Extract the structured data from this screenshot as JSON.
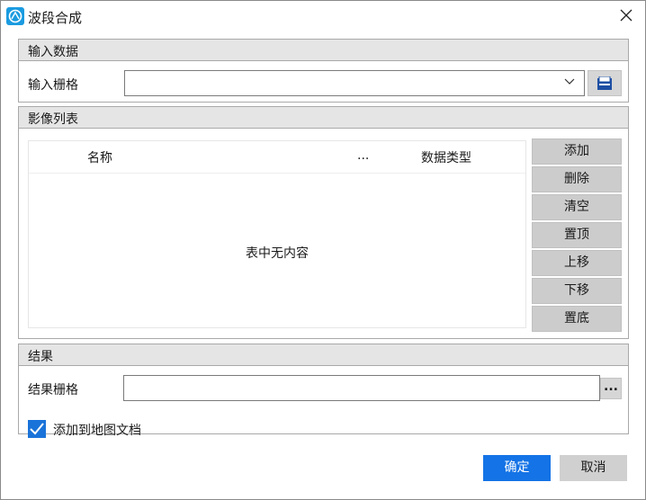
{
  "window": {
    "title": "波段合成"
  },
  "input_section": {
    "header": "输入数据",
    "raster_label": "输入栅格",
    "raster_value": ""
  },
  "list_section": {
    "header": "影像列表",
    "columns": [
      "名称",
      "...",
      "数据类型"
    ],
    "empty_text": "表中无内容",
    "buttons": {
      "add": "添加",
      "delete": "删除",
      "clear": "清空",
      "top": "置顶",
      "up": "上移",
      "down": "下移",
      "bottom": "置底"
    }
  },
  "result_section": {
    "header": "结果",
    "raster_label": "结果栅格",
    "raster_value": "",
    "browse_label": "...",
    "add_to_map_label": "添加到地图文档",
    "add_to_map_checked": true
  },
  "footer": {
    "ok": "确定",
    "cancel": "取消"
  },
  "icons": {
    "app": "app-logo-icon",
    "close": "close-icon",
    "dropdown": "chevron-down-icon",
    "folder": "open-data-icon",
    "check": "check-icon"
  },
  "colors": {
    "accent": "#1473e6",
    "header_bg": "#e5e5e5",
    "side_button_bg": "#cccccc"
  }
}
